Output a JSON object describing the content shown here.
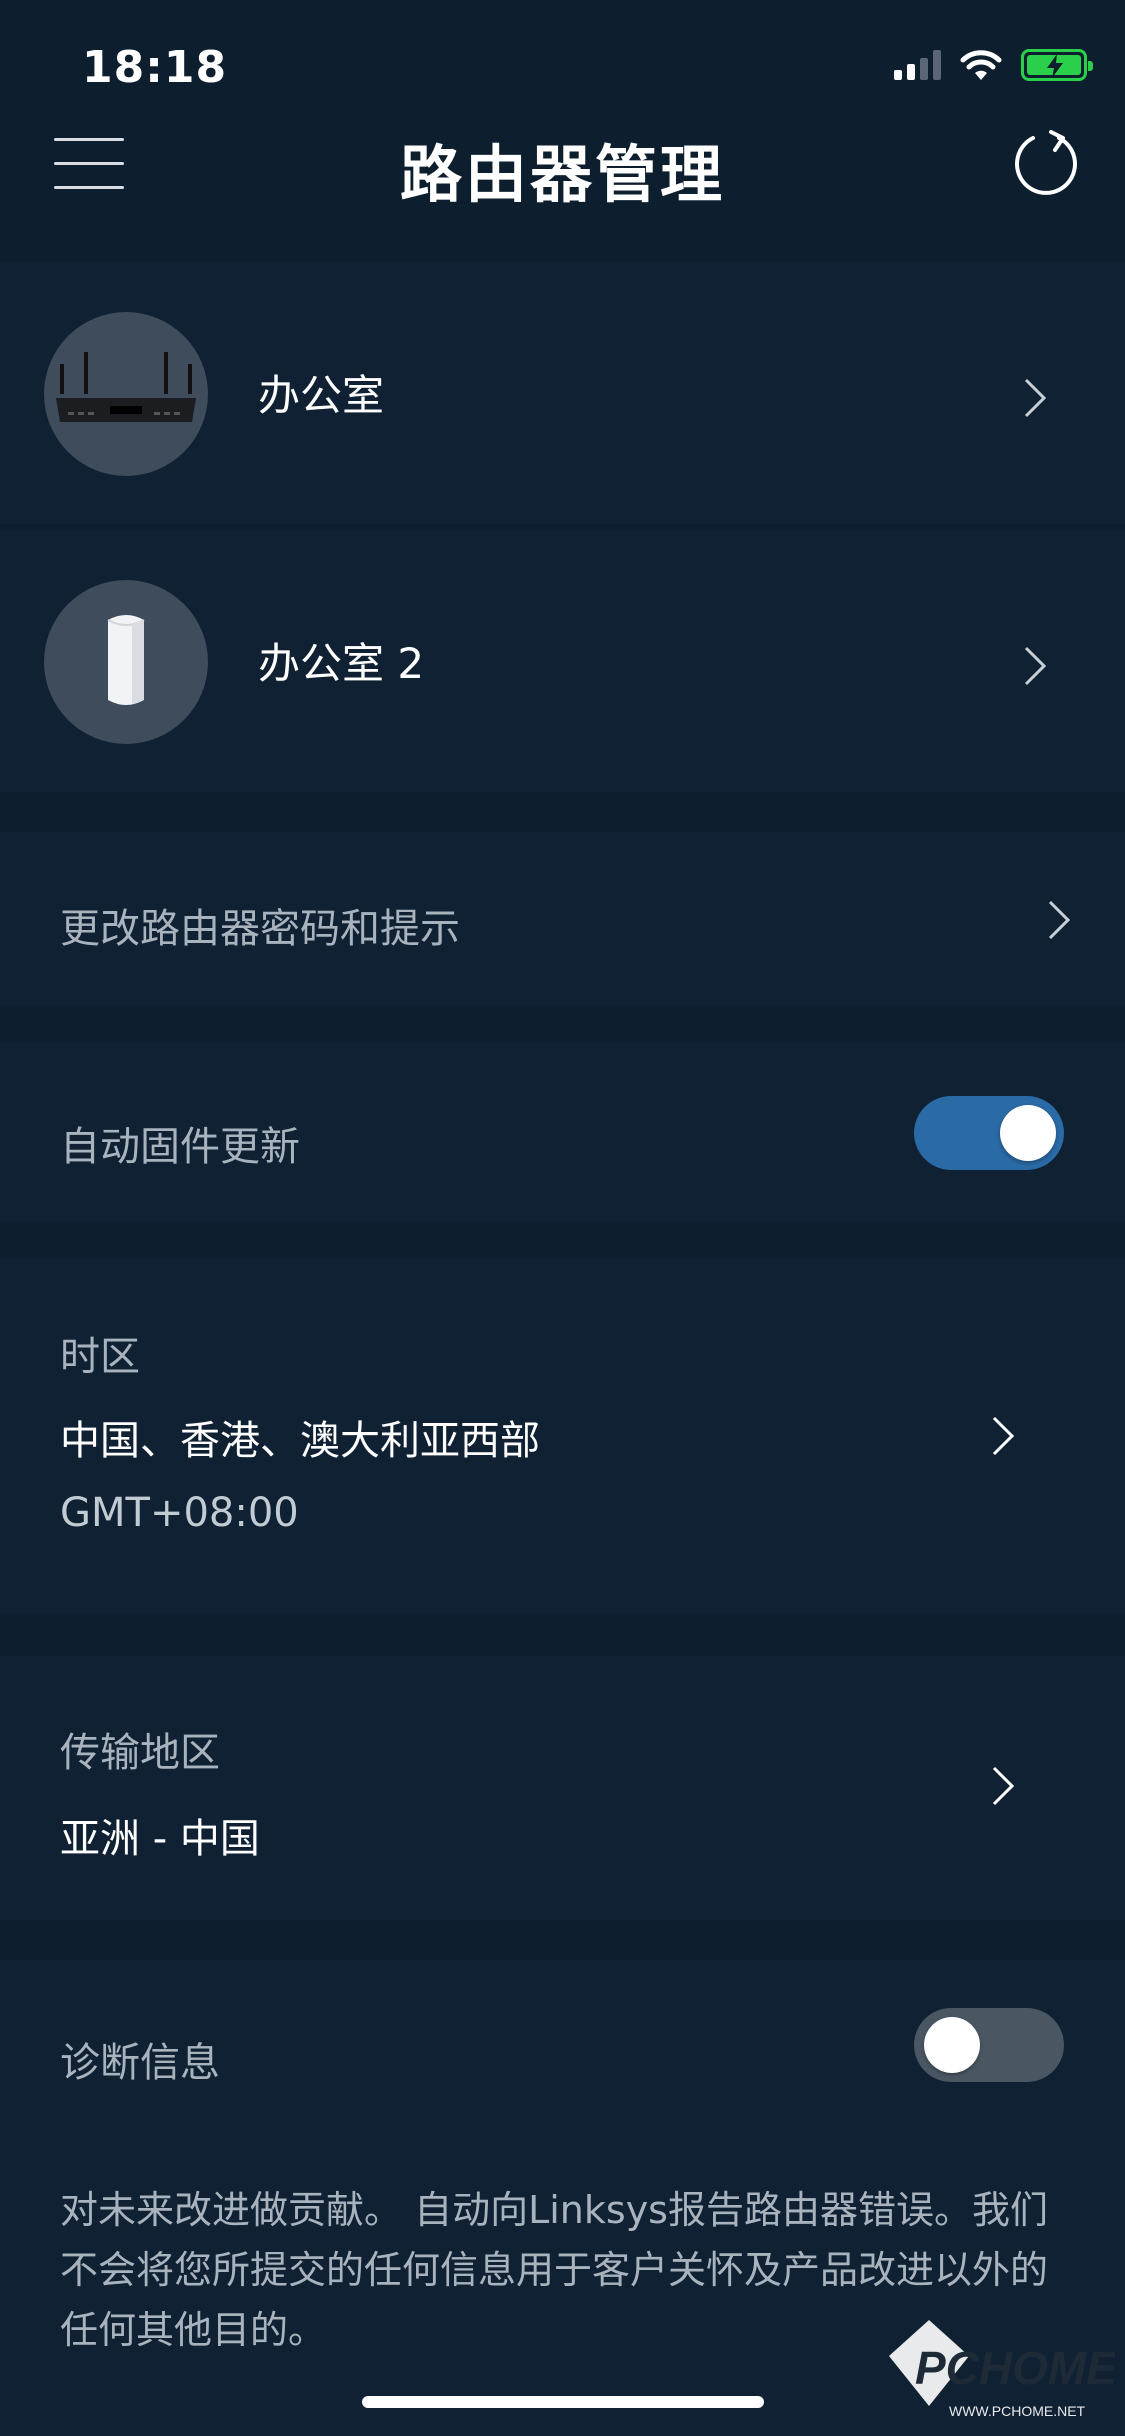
{
  "status_bar": {
    "time": "18:18"
  },
  "nav": {
    "title": "路由器管理"
  },
  "routers": [
    {
      "name": "办公室"
    },
    {
      "name": "办公室 2"
    }
  ],
  "settings": {
    "change_password": "更改路由器密码和提示",
    "auto_update": {
      "label": "自动固件更新",
      "enabled": true
    },
    "timezone": {
      "label": "时区",
      "value": "中国、香港、澳大利亚西部",
      "offset": "GMT+08:00"
    },
    "region": {
      "label": "传输地区",
      "value": "亚洲 - 中国"
    },
    "diagnostics": {
      "label": "诊断信息",
      "enabled": false,
      "description": "对未来改进做贡献。 自动向Linksys报告路由器错误。我们不会将您所提交的任何信息用于客户关怀及产品改进以外的任何其他目的。"
    }
  },
  "watermark": {
    "text": "PCHOME",
    "subtext": "WWW.PCHOME.NET"
  },
  "colors": {
    "background": "#0d1e2e",
    "card": "#0f2133",
    "toggle_on": "#2a6aa6",
    "toggle_off": "#4a5763",
    "battery": "#2bd04a"
  }
}
